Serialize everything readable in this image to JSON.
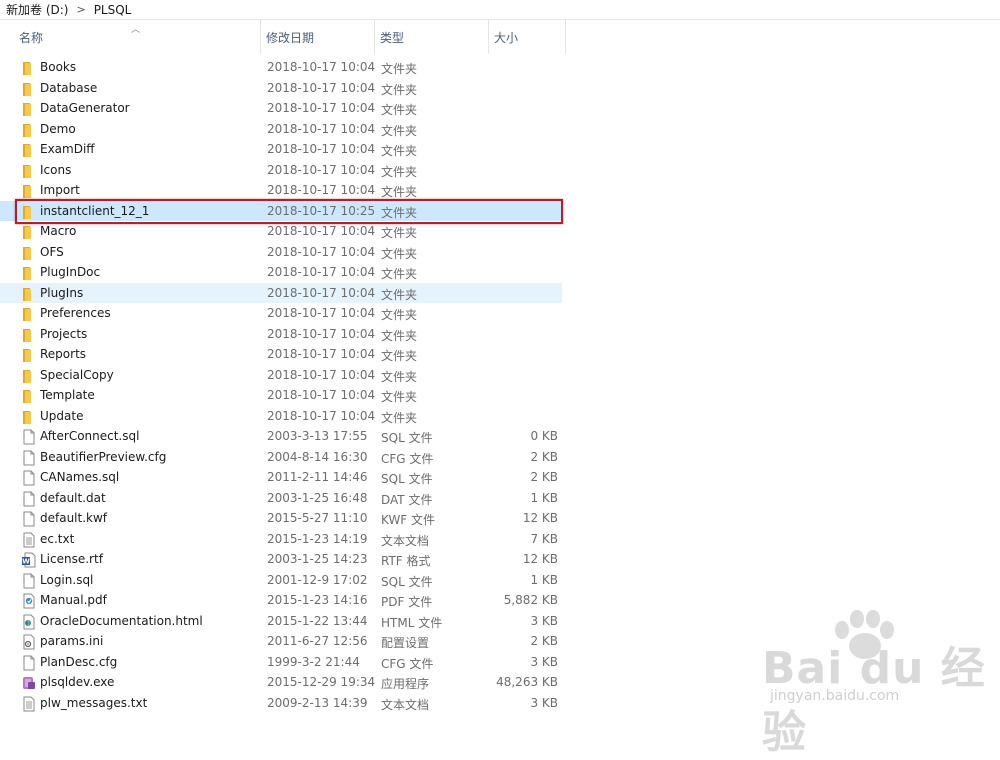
{
  "breadcrumb": {
    "drive": "新加卷 (D:)",
    "separator": ">",
    "folder": "PLSQL"
  },
  "columns": {
    "name": "名称",
    "date": "修改日期",
    "type": "类型",
    "size": "大小"
  },
  "files": [
    {
      "name": "Books",
      "date": "2018-10-17 10:04",
      "type": "文件夹",
      "size": "",
      "icon": "folder-icon"
    },
    {
      "name": "Database",
      "date": "2018-10-17 10:04",
      "type": "文件夹",
      "size": "",
      "icon": "folder-icon"
    },
    {
      "name": "DataGenerator",
      "date": "2018-10-17 10:04",
      "type": "文件夹",
      "size": "",
      "icon": "folder-icon"
    },
    {
      "name": "Demo",
      "date": "2018-10-17 10:04",
      "type": "文件夹",
      "size": "",
      "icon": "folder-icon"
    },
    {
      "name": "ExamDiff",
      "date": "2018-10-17 10:04",
      "type": "文件夹",
      "size": "",
      "icon": "folder-icon"
    },
    {
      "name": "Icons",
      "date": "2018-10-17 10:04",
      "type": "文件夹",
      "size": "",
      "icon": "folder-icon"
    },
    {
      "name": "Import",
      "date": "2018-10-17 10:04",
      "type": "文件夹",
      "size": "",
      "icon": "folder-icon"
    },
    {
      "name": "instantclient_12_1",
      "date": "2018-10-17 10:25",
      "type": "文件夹",
      "size": "",
      "icon": "folder-icon",
      "state": "selected"
    },
    {
      "name": "Macro",
      "date": "2018-10-17 10:04",
      "type": "文件夹",
      "size": "",
      "icon": "folder-icon"
    },
    {
      "name": "OFS",
      "date": "2018-10-17 10:04",
      "type": "文件夹",
      "size": "",
      "icon": "folder-icon"
    },
    {
      "name": "PlugInDoc",
      "date": "2018-10-17 10:04",
      "type": "文件夹",
      "size": "",
      "icon": "folder-icon"
    },
    {
      "name": "PlugIns",
      "date": "2018-10-17 10:04",
      "type": "文件夹",
      "size": "",
      "icon": "folder-icon",
      "state": "hover"
    },
    {
      "name": "Preferences",
      "date": "2018-10-17 10:04",
      "type": "文件夹",
      "size": "",
      "icon": "folder-icon"
    },
    {
      "name": "Projects",
      "date": "2018-10-17 10:04",
      "type": "文件夹",
      "size": "",
      "icon": "folder-icon"
    },
    {
      "name": "Reports",
      "date": "2018-10-17 10:04",
      "type": "文件夹",
      "size": "",
      "icon": "folder-icon"
    },
    {
      "name": "SpecialCopy",
      "date": "2018-10-17 10:04",
      "type": "文件夹",
      "size": "",
      "icon": "folder-icon"
    },
    {
      "name": "Template",
      "date": "2018-10-17 10:04",
      "type": "文件夹",
      "size": "",
      "icon": "folder-icon"
    },
    {
      "name": "Update",
      "date": "2018-10-17 10:04",
      "type": "文件夹",
      "size": "",
      "icon": "folder-icon"
    },
    {
      "name": "AfterConnect.sql",
      "date": "2003-3-13 17:55",
      "type": "SQL 文件",
      "size": "0 KB",
      "icon": "file-icon"
    },
    {
      "name": "BeautifierPreview.cfg",
      "date": "2004-8-14 16:30",
      "type": "CFG 文件",
      "size": "2 KB",
      "icon": "file-icon"
    },
    {
      "name": "CANames.sql",
      "date": "2011-2-11 14:46",
      "type": "SQL 文件",
      "size": "2 KB",
      "icon": "file-icon"
    },
    {
      "name": "default.dat",
      "date": "2003-1-25 16:48",
      "type": "DAT 文件",
      "size": "1 KB",
      "icon": "file-icon"
    },
    {
      "name": "default.kwf",
      "date": "2015-5-27 11:10",
      "type": "KWF 文件",
      "size": "12 KB",
      "icon": "file-icon"
    },
    {
      "name": "ec.txt",
      "date": "2015-1-23 14:19",
      "type": "文本文档",
      "size": "7 KB",
      "icon": "text-file-icon"
    },
    {
      "name": "License.rtf",
      "date": "2003-1-25 14:23",
      "type": "RTF 格式",
      "size": "12 KB",
      "icon": "word-doc-icon"
    },
    {
      "name": "Login.sql",
      "date": "2001-12-9 17:02",
      "type": "SQL 文件",
      "size": "1 KB",
      "icon": "file-icon"
    },
    {
      "name": "Manual.pdf",
      "date": "2015-1-23 14:16",
      "type": "PDF 文件",
      "size": "5,882 KB",
      "icon": "pdf-icon"
    },
    {
      "name": "OracleDocumentation.html",
      "date": "2015-1-22 13:44",
      "type": "HTML 文件",
      "size": "3 KB",
      "icon": "html-icon"
    },
    {
      "name": "params.ini",
      "date": "2011-6-27 12:56",
      "type": "配置设置",
      "size": "2 KB",
      "icon": "ini-file-icon"
    },
    {
      "name": "PlanDesc.cfg",
      "date": "1999-3-2 21:44",
      "type": "CFG 文件",
      "size": "3 KB",
      "icon": "file-icon"
    },
    {
      "name": "plsqldev.exe",
      "date": "2015-12-29 19:34",
      "type": "应用程序",
      "size": "48,263 KB",
      "icon": "exe-icon"
    },
    {
      "name": "plw_messages.txt",
      "date": "2009-2-13 14:39",
      "type": "文本文档",
      "size": "3 KB",
      "icon": "text-file-icon"
    }
  ],
  "watermark": {
    "brand": "Bai du 经验",
    "url": "jingyan.baidu.com"
  },
  "colors": {
    "selected_bg": "#cce8ff",
    "hover_bg": "#e5f3ff",
    "highlight_border": "#c01b24",
    "folder": "#f8c846"
  }
}
